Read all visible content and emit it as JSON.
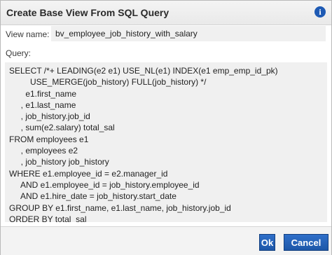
{
  "dialog": {
    "title": "Create Base View From SQL Query",
    "info_icon": "info-icon"
  },
  "form": {
    "view_name_label": "View name:",
    "view_name_value": "bv_employee_job_history_with_salary",
    "query_label": "Query:",
    "query_value": "SELECT /*+ LEADING(e2 e1) USE_NL(e1) INDEX(e1 emp_emp_id_pk)\n         USE_MERGE(job_history) FULL(job_history) */\n       e1.first_name\n     , e1.last_name\n     , job_history.job_id\n     , sum(e2.salary) total_sal\nFROM employees e1\n     , employees e2\n     , job_history job_history\nWHERE e1.employee_id = e2.manager_id\n     AND e1.employee_id = job_history.employee_id\n     AND e1.hire_date = job_history.start_date\nGROUP BY e1.first_name, e1.last_name, job_history.job_id\nORDER BY total_sal"
  },
  "buttons": {
    "ok_label": "Ok",
    "cancel_label": "Cancel"
  }
}
